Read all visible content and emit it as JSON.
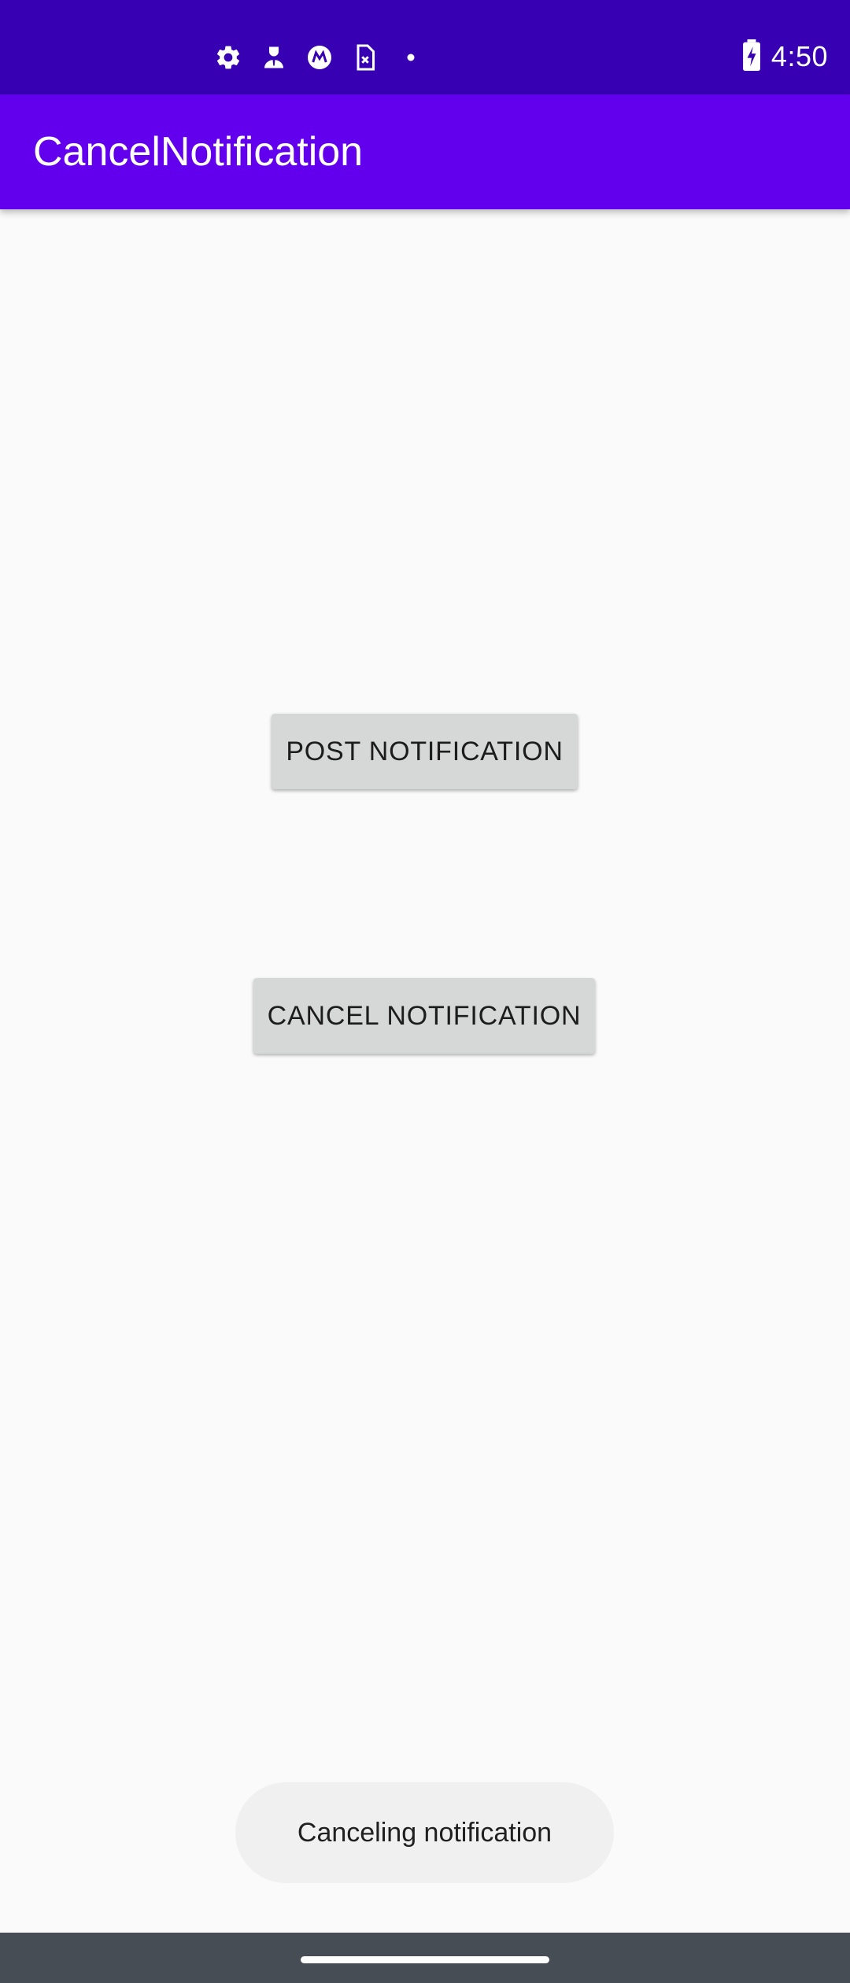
{
  "status_bar": {
    "time": "4:50",
    "icons": [
      "settings-icon",
      "account-icon",
      "motorola-icon",
      "no-sim-icon",
      "dot-icon"
    ],
    "battery": "battery-charging-icon",
    "background": "#3700b3"
  },
  "app_bar": {
    "title": "CancelNotification",
    "background": "#6200ee"
  },
  "buttons": {
    "post_label": "POST NOTIFICATION",
    "cancel_label": "CANCEL NOTIFICATION"
  },
  "toast": {
    "message": "Canceling notification"
  },
  "colors": {
    "background": "#fafafa",
    "button": "#d6d7d7",
    "toast": "#f0f0f0",
    "nav_bar": "#474d54"
  }
}
